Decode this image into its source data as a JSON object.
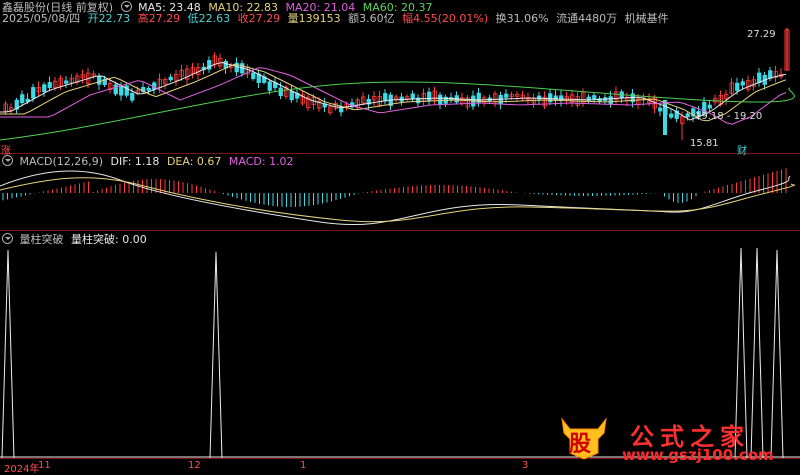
{
  "info": {
    "name_date": "鑫磊股份(日线 前复权)",
    "date": "2025/05/08/四",
    "open": "开22.73",
    "high": "高27.29",
    "low": "低22.63",
    "close": "收27.29",
    "volume": "量139153",
    "amount": "额3.60亿",
    "change": "幅4.55(20.01%)",
    "turnover": "换31.06%",
    "float": "流通4480万",
    "industry": "机械基件"
  },
  "ma": {
    "ma5": "MA5: 23.48",
    "ma10": "MA10: 22.83",
    "ma20": "MA20: 21.04",
    "ma60": "MA60: 20.37"
  },
  "price_labels": {
    "high_mark": "27.29",
    "range_mark": "19.18 - 19.20",
    "low_mark": "15.81",
    "zhang": "涨",
    "cai": "财"
  },
  "macd": {
    "title": "MACD(12,26,9)",
    "dif": "DIF: 1.18",
    "dea": "DEA: 0.67",
    "macd": "MACD: 1.02"
  },
  "indicator": {
    "title": "量柱突破",
    "value": "量柱突破: 0.00"
  },
  "xaxis": {
    "year": "2024年",
    "m11": "11",
    "m12": "12",
    "m1": "1",
    "m3": "3"
  },
  "watermark": {
    "badge": "股",
    "cn": "公式之家",
    "url": "www.gszj100.com"
  },
  "colors": {
    "up": "#ff3b3b",
    "down": "#3fd9e6",
    "ma5": "#e8e8e8",
    "ma10": "#e6d27a",
    "ma20": "#e060e0",
    "ma60": "#4fd14f",
    "grid": "#7a1515"
  }
}
